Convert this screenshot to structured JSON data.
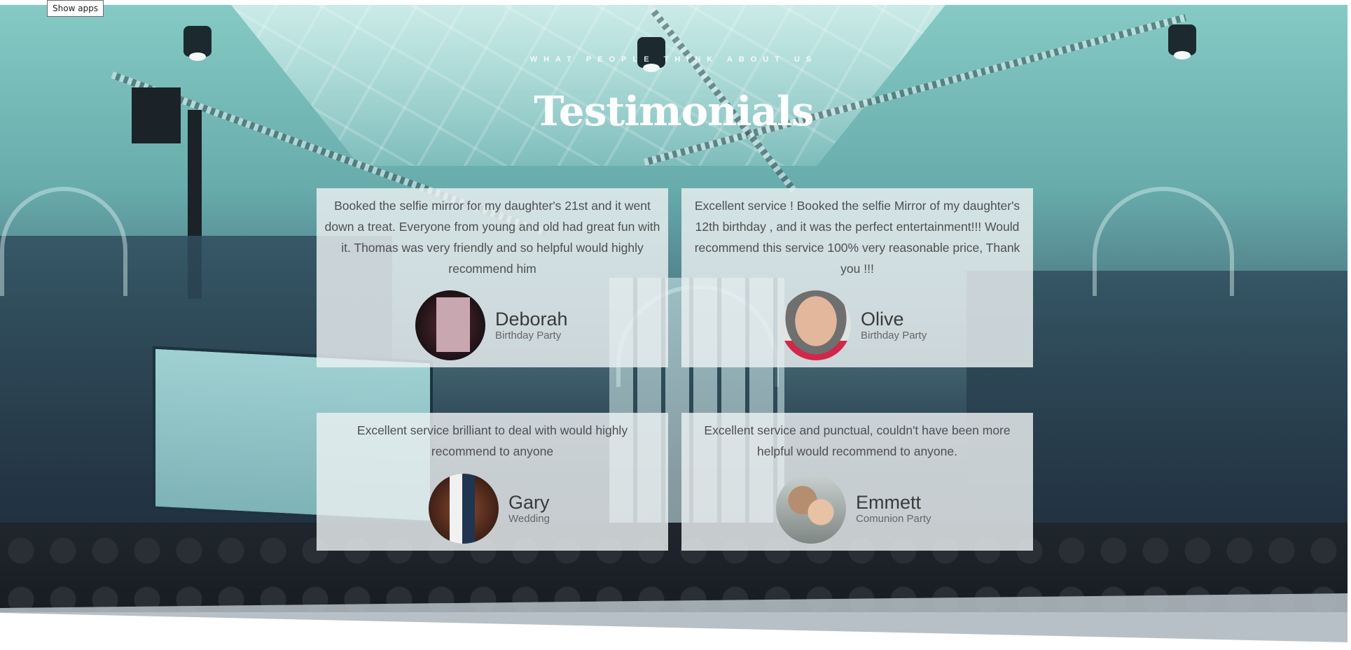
{
  "tooltip": "Show apps",
  "section": {
    "kicker": "WHAT PEOPLE THINK ABOUT US",
    "title": "Testimonials"
  },
  "testimonials": [
    {
      "quote": "Booked the selfie mirror for my daughter's 21st and it went down a treat. Everyone from young and old had great fun with it. Thomas was very friendly and so helpful would highly recommend him",
      "name": "Deborah",
      "event": "Birthday Party",
      "avatar_icon": "avatar-photo"
    },
    {
      "quote": "Excellent service ! Booked the selfie Mirror of my daughter's 12th birthday , and it was the perfect entertainment!!! Would recommend this service 100% very reasonable price, Thank you !!!",
      "name": "Olive",
      "event": "Birthday Party",
      "avatar_icon": "avatar-photo"
    },
    {
      "quote": "Excellent service brilliant to deal with would highly recommend to anyone",
      "name": "Gary",
      "event": "Wedding",
      "avatar_icon": "avatar-photo"
    },
    {
      "quote": "Excellent service and punctual, couldn't have been more helpful would recommend to anyone.",
      "name": "Emmett",
      "event": "Comunion Party",
      "avatar_icon": "avatar-photo"
    }
  ]
}
